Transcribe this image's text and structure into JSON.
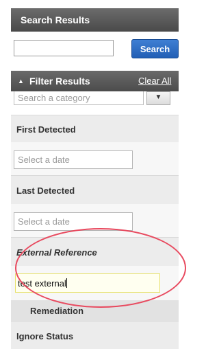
{
  "header": {
    "title": "Search Results"
  },
  "search": {
    "value": "",
    "button_label": "Search"
  },
  "filter": {
    "title": "Filter Results",
    "clear_label": "Clear All",
    "category_placeholder": "Search a category",
    "dropdown_glyph": "▼"
  },
  "sections": {
    "first_detected": {
      "label": "First Detected",
      "placeholder": "Select a date"
    },
    "last_detected": {
      "label": "Last Detected",
      "placeholder": "Select a date"
    },
    "external_reference": {
      "label": "External Reference",
      "value": "test external"
    },
    "remediation": {
      "label": "Remediation"
    },
    "ignore_status": {
      "label": "Ignore Status"
    }
  },
  "annotation": {
    "color": "#e84a5f"
  }
}
